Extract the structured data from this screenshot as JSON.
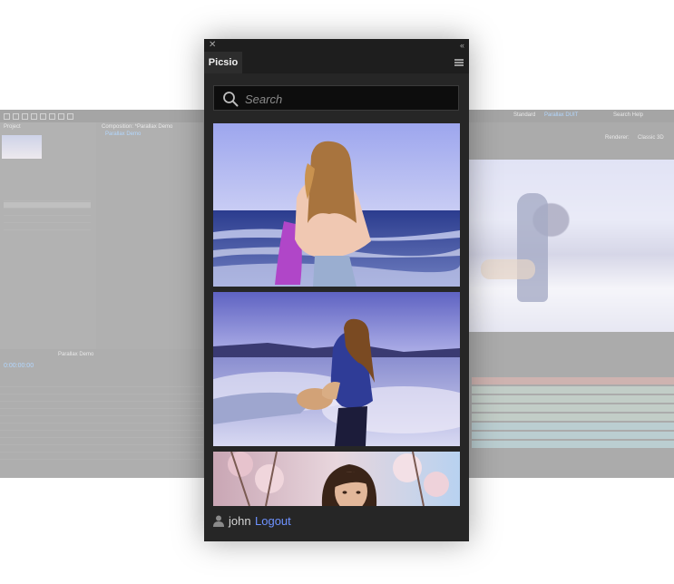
{
  "background_app": {
    "toolbar": {
      "workspace_label": "Standard",
      "workspace_active": "Parallax DUIT",
      "help_search": "Search Help"
    },
    "project_tab": "Project",
    "composition_tab": "Composition: *Parallax Demo",
    "comp_name": "Parallax Demo",
    "timeline_tab": "Parallax Demo",
    "timecode": "0:00:00:00",
    "renderer_label": "Renderer:",
    "renderer_value": "Classic 3D"
  },
  "panel": {
    "tab_label": "Picsio",
    "search": {
      "placeholder": "Search",
      "value": ""
    },
    "results": [
      {
        "label": "woman-on-beach"
      },
      {
        "label": "follow-me-above-clouds"
      },
      {
        "label": "woman-cherry-blossoms"
      }
    ],
    "footer": {
      "username": "john",
      "logout_label": "Logout"
    }
  },
  "colors": {
    "panel_bg": "#262626",
    "search_bg": "#0d0d0d",
    "link_accent": "#6e92ff",
    "timecode_accent": "#4ba2ff"
  },
  "icons": [
    "close-icon",
    "collapse-icon",
    "menu-icon",
    "search-icon",
    "user-icon"
  ]
}
